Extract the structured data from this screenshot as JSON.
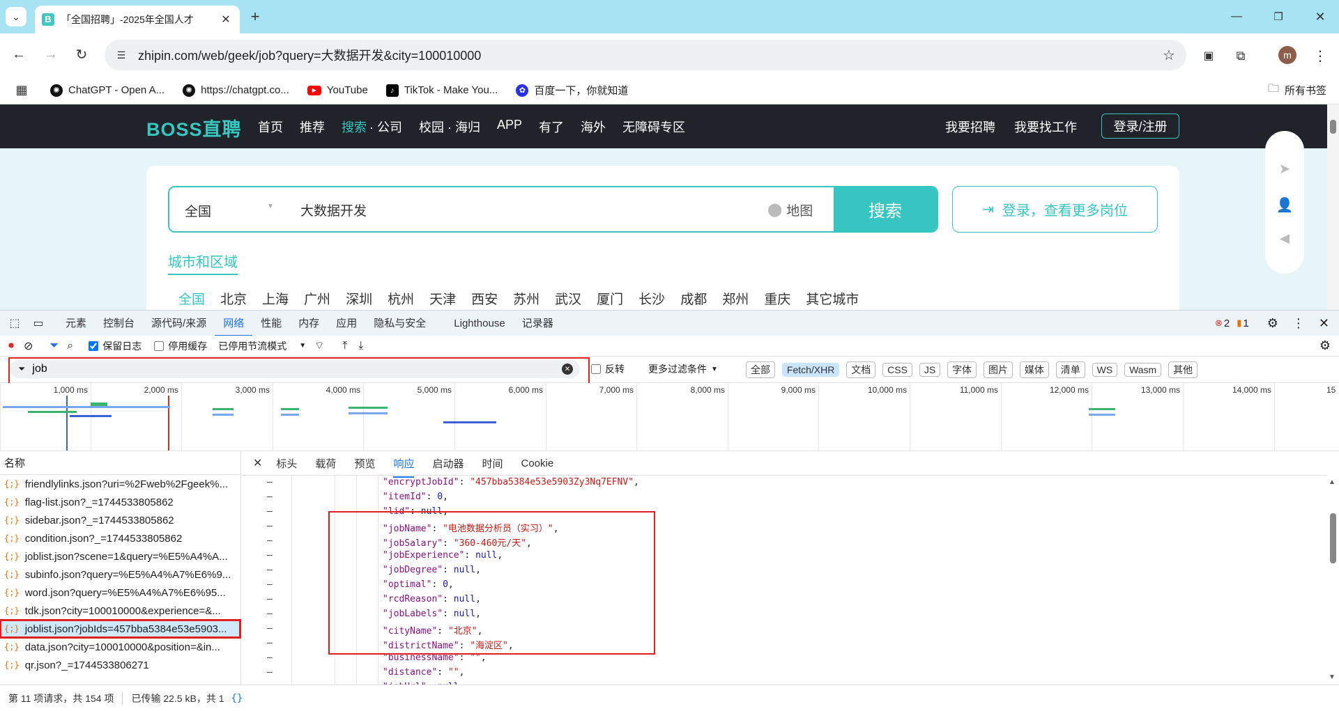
{
  "browser": {
    "tab_title": "「全国招聘」-2025年全国人才",
    "tab_favicon": "B",
    "url": "zhipin.com/web/geek/job?query=大数据开发&city=100010000",
    "profile": "m",
    "bookmarks": [
      {
        "label": "ChatGPT - Open A..."
      },
      {
        "label": "https://chatgpt.co..."
      },
      {
        "label": "YouTube"
      },
      {
        "label": "TikTok - Make You..."
      },
      {
        "label": "百度一下，你就知道"
      }
    ],
    "all_bookmarks": "所有书签"
  },
  "site": {
    "logo": "BOSS直聘",
    "nav": [
      "首页",
      "推荐",
      "搜索",
      "· 公司",
      "校园 · 海归",
      "APP",
      "有了",
      "海外",
      "无障碍专区"
    ],
    "right_nav": [
      "我要招聘",
      "我要找工作"
    ],
    "login_btn": "登录/注册",
    "city_select": "全国",
    "query": "大数据开发",
    "map_label": "地图",
    "search_btn": "搜索",
    "login_more": "登录，查看更多岗位",
    "city_section": "城市和区域",
    "cities": [
      "全国",
      "北京",
      "上海",
      "广州",
      "深圳",
      "杭州",
      "天津",
      "西安",
      "苏州",
      "武汉",
      "厦门",
      "长沙",
      "成都",
      "郑州",
      "重庆",
      "其它城市"
    ]
  },
  "devtools": {
    "tabs": [
      "元素",
      "控制台",
      "源代码/来源",
      "网络",
      "性能",
      "内存",
      "应用",
      "隐私与安全",
      "Lighthouse",
      "记录器"
    ],
    "errors": "2",
    "warnings": "1",
    "preserve_log": "保留日志",
    "disable_cache": "停用缓存",
    "throttle": "已停用节流模式",
    "filter": "job",
    "invert": "反转",
    "more_filters": "更多过滤条件",
    "types": [
      "全部",
      "Fetch/XHR",
      "文档",
      "CSS",
      "JS",
      "字体",
      "图片",
      "媒体",
      "清单",
      "WS",
      "Wasm",
      "其他"
    ],
    "ticks": [
      "1,000 ms",
      "2,000 ms",
      "3,000 ms",
      "4,000 ms",
      "5,000 ms",
      "6,000 ms",
      "7,000 ms",
      "8,000 ms",
      "9,000 ms",
      "10,000 ms",
      "11,000 ms",
      "12,000 ms",
      "13,000 ms",
      "14,000 ms",
      "15"
    ],
    "name_header": "名称",
    "requests": [
      "friendlylinks.json?uri=%2Fweb%2Fgeek%...",
      "flag-list.json?_=1744533805862",
      "sidebar.json?_=1744533805862",
      "condition.json?_=1744533805862",
      "joblist.json?scene=1&query=%E5%A4%A...",
      "subinfo.json?query=%E5%A4%A7%E6%9...",
      "word.json?query=%E5%A4%A7%E6%95...",
      "tdk.json?city=100010000&experience=&...",
      "joblist.json?jobIds=457bba5384e53e5903...",
      "data.json?city=100010000&position=&in...",
      "qr.json?_=1744533806271"
    ],
    "resp_tabs": [
      "标头",
      "载荷",
      "预览",
      "响应",
      "启动器",
      "时间",
      "Cookie"
    ],
    "code_lines": [
      {
        "k": "\"encryptJobId\"",
        "v": "\"457bba5384e53e5903Zy3Nq7EFNV\"",
        "t": "s"
      },
      {
        "k": "\"itemId\"",
        "v": "0",
        "t": "n"
      },
      {
        "k": "\"lid\"",
        "v": "null",
        "t": "n"
      },
      {
        "k": "\"jobName\"",
        "v": "\"电池数据分析员（实习）\"",
        "t": "s"
      },
      {
        "k": "\"jobSalary\"",
        "v": "\"360-460元/天\"",
        "t": "s"
      },
      {
        "k": "\"jobExperience\"",
        "v": "null",
        "t": "n"
      },
      {
        "k": "\"jobDegree\"",
        "v": "null",
        "t": "n"
      },
      {
        "k": "\"optimal\"",
        "v": "0",
        "t": "n"
      },
      {
        "k": "\"rcdReason\"",
        "v": "null",
        "t": "n"
      },
      {
        "k": "\"jobLabels\"",
        "v": "null",
        "t": "n"
      },
      {
        "k": "\"cityName\"",
        "v": "\"北京\"",
        "t": "s"
      },
      {
        "k": "\"districtName\"",
        "v": "\"海淀区\"",
        "t": "s"
      },
      {
        "k": "\"businessName\"",
        "v": "\"\"",
        "t": "s"
      },
      {
        "k": "\"distance\"",
        "v": "\"\"",
        "t": "s"
      },
      {
        "k": "\"jobUrl\"",
        "v": "null",
        "t": "n"
      }
    ],
    "status": [
      "第 11 项请求，共 154 项",
      "已传输 22.5 kB，共 1"
    ]
  }
}
